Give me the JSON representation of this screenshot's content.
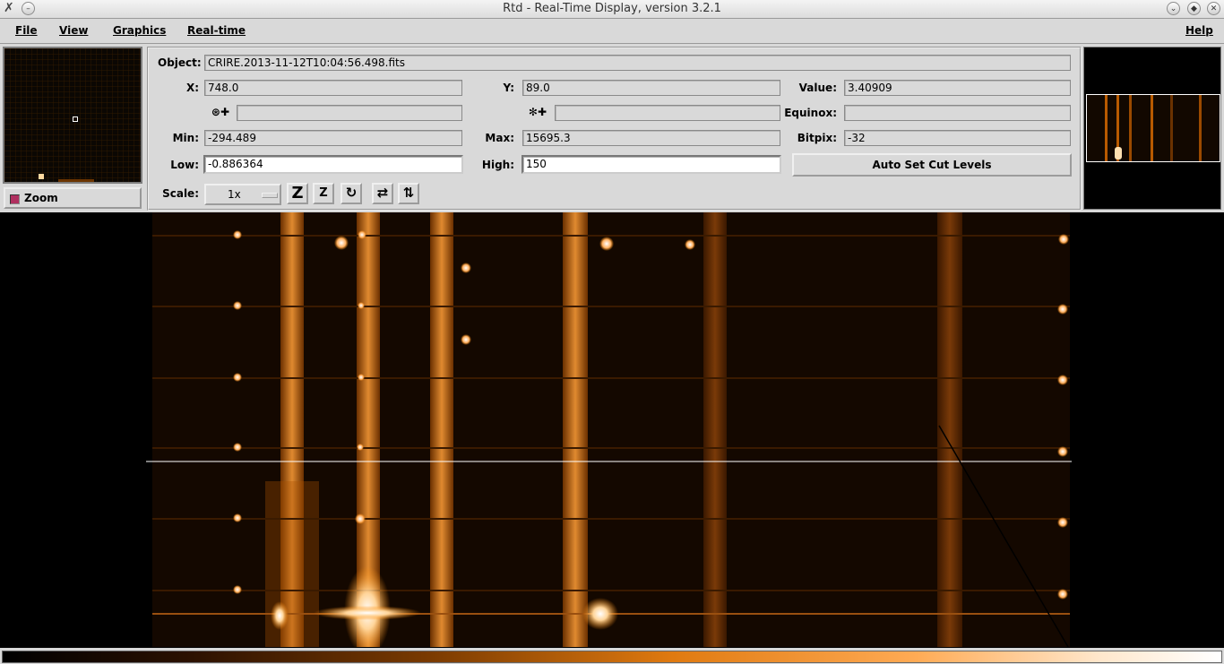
{
  "window": {
    "title": "Rtd - Real-Time Display, version 3.2.1"
  },
  "menu": {
    "file": "File",
    "view": "View",
    "graphics": "Graphics",
    "realtime": "Real-time",
    "help": "Help"
  },
  "zoom": {
    "label": "Zoom",
    "checked": true
  },
  "info": {
    "object_label": "Object:",
    "object_value": "CRIRE.2013-11-12T10:04:56.498.fits",
    "x_label": "X:",
    "x_value": "748.0",
    "y_label": "Y:",
    "y_value": "89.0",
    "value_label": "Value:",
    "value_value": "3.40909",
    "ra_value": "",
    "dec_value": "",
    "equinox_label": "Equinox:",
    "equinox_value": "",
    "min_label": "Min:",
    "min_value": "-294.489",
    "max_label": "Max:",
    "max_value": "15695.3",
    "bitpix_label": "Bitpix:",
    "bitpix_value": "-32",
    "low_label": "Low:",
    "low_value": "-0.886364",
    "high_label": "High:",
    "high_value": "150",
    "auto_cut_label": "Auto Set Cut Levels",
    "scale_label": "Scale:",
    "scale_value": "1x"
  },
  "colors": {
    "colormap_low": "#000000",
    "colormap_mid": "#e07a10",
    "colormap_high": "#ffffff",
    "panel_bg": "#d9d9d9"
  }
}
